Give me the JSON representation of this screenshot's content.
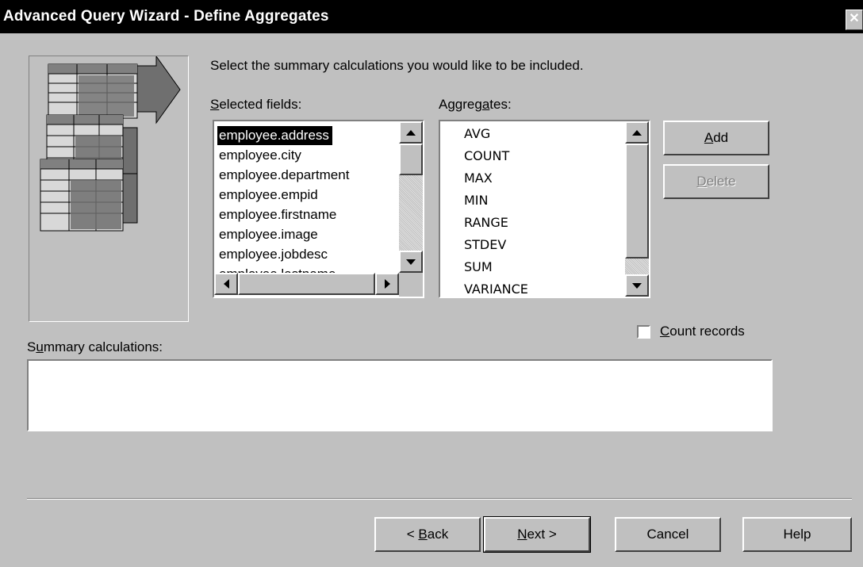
{
  "window": {
    "title": "Advanced Query Wizard - Define Aggregates",
    "close_glyph": "✕"
  },
  "instruction": "Select the summary calculations you would like to be included.",
  "selected_fields": {
    "label_accel": "S",
    "label_rest": "elected fields:",
    "items": [
      "employee.address",
      "employee.city",
      "employee.department",
      "employee.empid",
      "employee.firstname",
      "employee.image",
      "employee.jobdesc",
      "employee.lastname"
    ],
    "selected_index": 0
  },
  "aggregates": {
    "label_pre": "Aggreg",
    "label_accel": "a",
    "label_post": "tes:",
    "items": [
      "AVG",
      "COUNT",
      "MAX",
      "MIN",
      "RANGE",
      "STDEV",
      "SUM",
      "VARIANCE"
    ]
  },
  "buttons": {
    "add": {
      "accel": "A",
      "rest": "dd"
    },
    "delete": {
      "accel": "D",
      "rest": "elete"
    },
    "back": {
      "pre": "< ",
      "accel": "B",
      "rest": "ack"
    },
    "next": {
      "accel": "N",
      "rest": "ext >"
    },
    "cancel": "Cancel",
    "help": "Help"
  },
  "count_records": {
    "accel": "C",
    "rest": "ount records",
    "checked": false
  },
  "summary": {
    "label_pre": "S",
    "label_accel": "u",
    "label_post": "mmary calculations:",
    "value": ""
  },
  "colors": {
    "titlebar": "#000000",
    "face": "#c0c0c0",
    "selection": "#000000"
  }
}
